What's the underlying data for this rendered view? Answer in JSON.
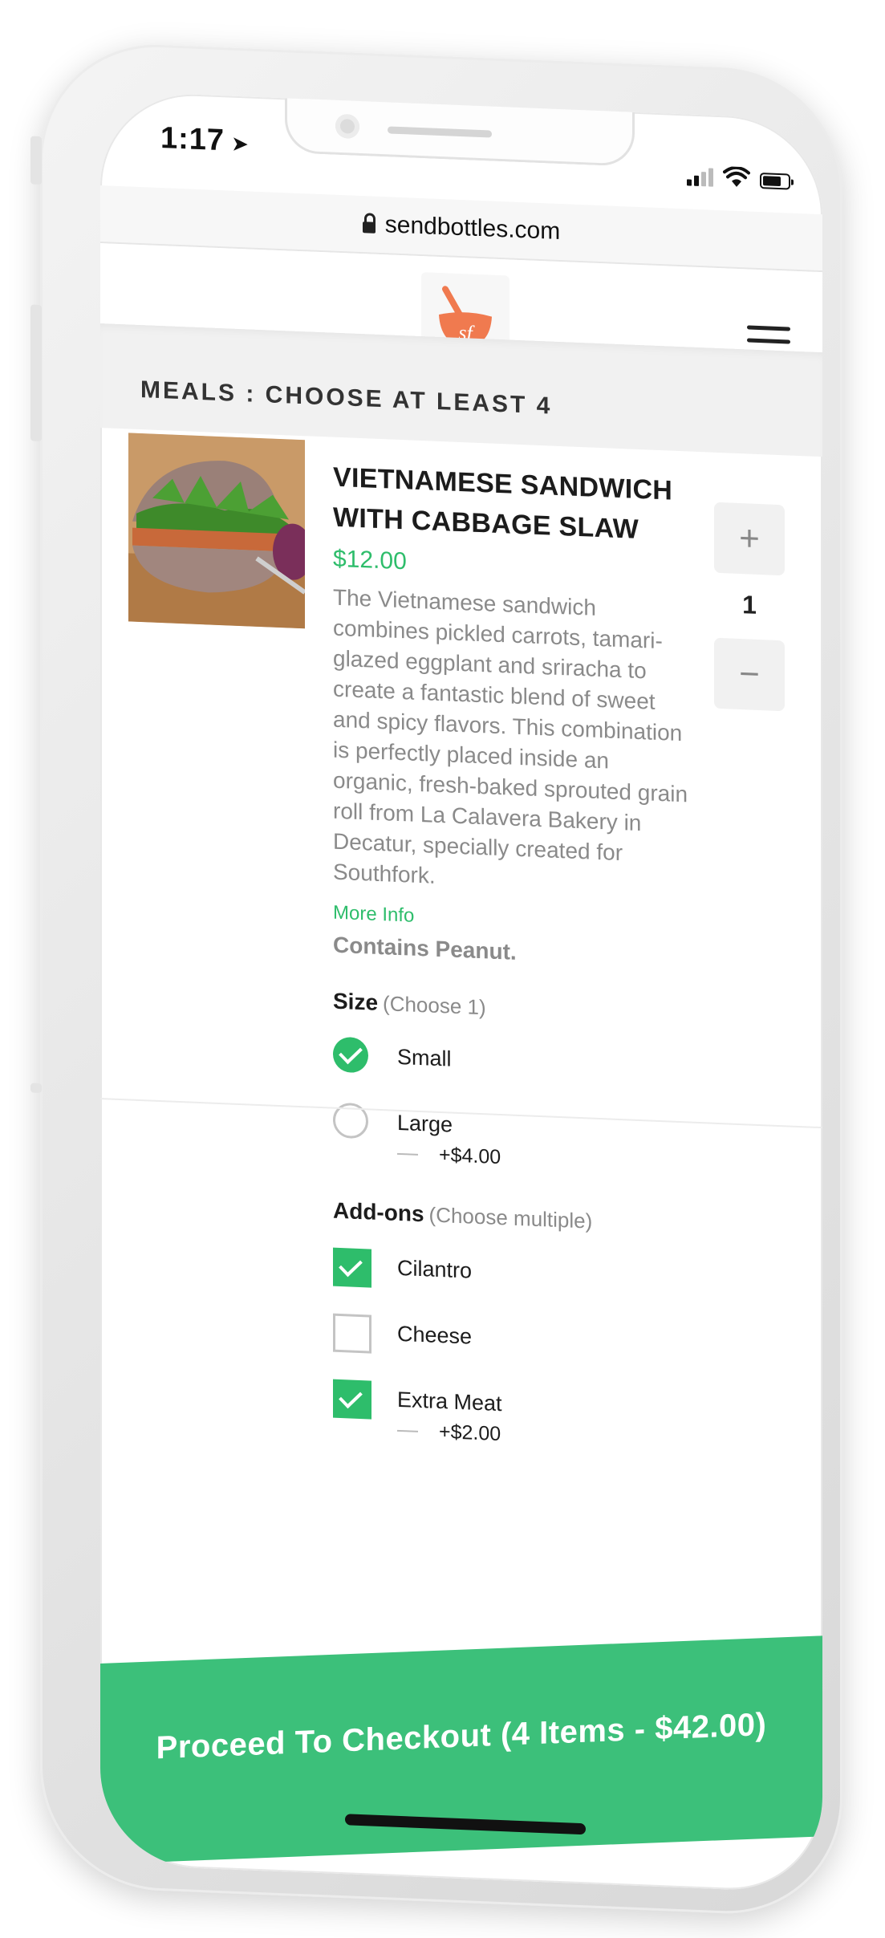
{
  "status_bar": {
    "time": "1:17",
    "location_arrow": "➤"
  },
  "browser": {
    "url": "sendbottles.com"
  },
  "brand": {
    "logo_text": "sf",
    "accent": "#2ebd6b",
    "logo_color": "#f07a4f"
  },
  "section": {
    "title": "MEALS : CHOOSE AT LEAST 4"
  },
  "meal": {
    "title": "VIETNAMESE SANDWICH WITH CABBAGE SLAW",
    "price": "$12.00",
    "description": "The Vietnamese sandwich combines pickled carrots, tamari-glazed eggplant and sriracha to create a fantastic blend of sweet and spicy flavors. This combination is perfectly placed inside an organic, fresh-baked sprouted grain roll from La Calavera Bakery in Decatur, specially created for Southfork.",
    "more_info": "More Info",
    "allergen": "Contains Peanut.",
    "quantity": "1",
    "plus": "+",
    "minus": "−",
    "size": {
      "label": "Size",
      "hint": "(Choose 1)",
      "options": [
        {
          "label": "Small",
          "selected": true,
          "extra": ""
        },
        {
          "label": "Large",
          "selected": false,
          "extra": "+$4.00"
        }
      ]
    },
    "addons": {
      "label": "Add-ons",
      "hint": "(Choose multiple)",
      "options": [
        {
          "label": "Cilantro",
          "checked": true,
          "extra": ""
        },
        {
          "label": "Cheese",
          "checked": false,
          "extra": ""
        },
        {
          "label": "Extra Meat",
          "checked": true,
          "extra": "+$2.00"
        }
      ]
    }
  },
  "checkout": {
    "label": "Proceed To Checkout (4 Items - $42.00)"
  }
}
